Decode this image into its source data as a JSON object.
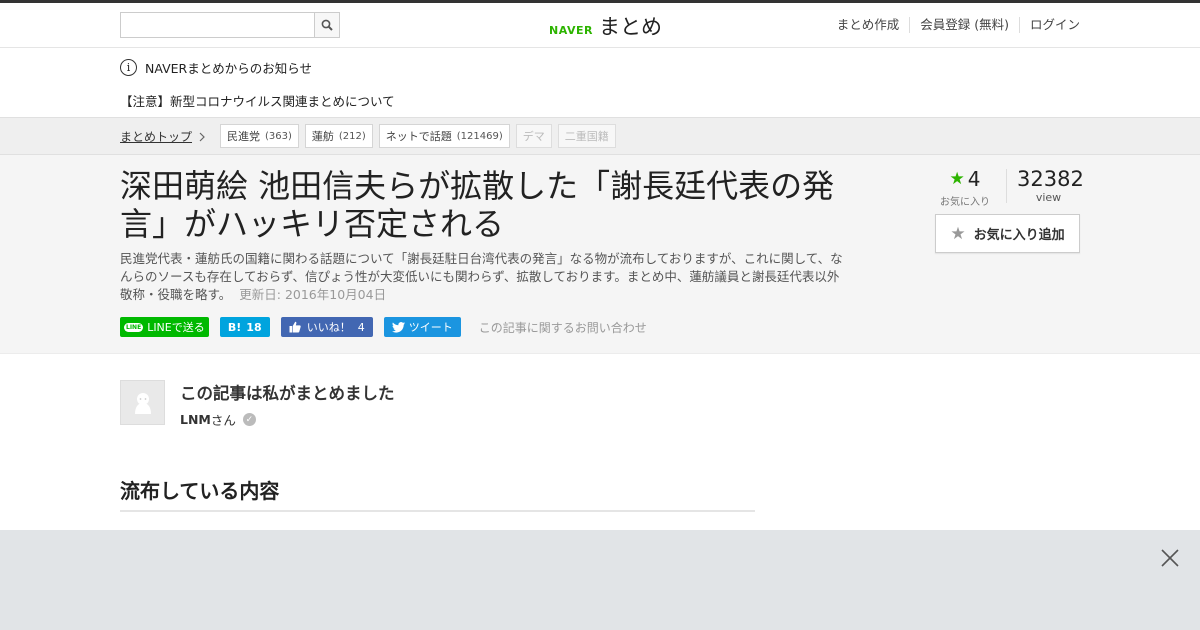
{
  "header": {
    "search_placeholder": "",
    "logo_naver": "NAVER",
    "logo_matome": "まとめ",
    "nav": [
      "まとめ作成",
      "会員登録 (無料)",
      "ログイン"
    ]
  },
  "notice": {
    "info_text": "NAVERまとめからのお知らせ",
    "warning_text": "【注意】新型コロナウイルス関連まとめについて"
  },
  "breadcrumb": {
    "top_label": "まとめトップ",
    "tags": [
      {
        "label": "民進党",
        "count": "(363)"
      },
      {
        "label": "蓮舫",
        "count": "(212)"
      },
      {
        "label": "ネットで話題",
        "count": "(121469)"
      },
      {
        "label": "デマ",
        "count": ""
      },
      {
        "label": "二重国籍",
        "count": ""
      }
    ]
  },
  "article": {
    "title": "深田萌絵 池田信夫らが拡散した「謝長廷代表の発言」がハッキリ否定される",
    "description": "民進党代表・蓮舫氏の国籍に関わる話題について「謝長廷駐日台湾代表の発言」なる物が流布しておりますが、これに関して、なんらのソースも存在しておらず、信ぴょう性が大変低いにも関わらず、拡散しております。まとめ中、蓮舫議員と謝長廷代表以外敬称・役職を略す。",
    "updated": "更新日: 2016年10月04日",
    "fav_count": "4",
    "fav_label": "お気に入り",
    "views": "32382",
    "views_label": "view",
    "fav_button": "お気に入り追加"
  },
  "share": {
    "line_label": "LINEで送る",
    "hatena_count": "18",
    "fb_label": "いいね！",
    "fb_count": "4",
    "tweet_label": "ツイート",
    "contact": "この記事に関するお問い合わせ"
  },
  "author": {
    "heading": "この記事は私がまとめました",
    "name": "LNM",
    "suffix": "さん"
  },
  "section_title": "流布している内容",
  "colors": {
    "brand_green": "#2db400",
    "line_green": "#00b900",
    "hatena_blue": "#00a4de",
    "fb_blue": "#4267b2",
    "twitter_blue": "#1b95e0"
  }
}
